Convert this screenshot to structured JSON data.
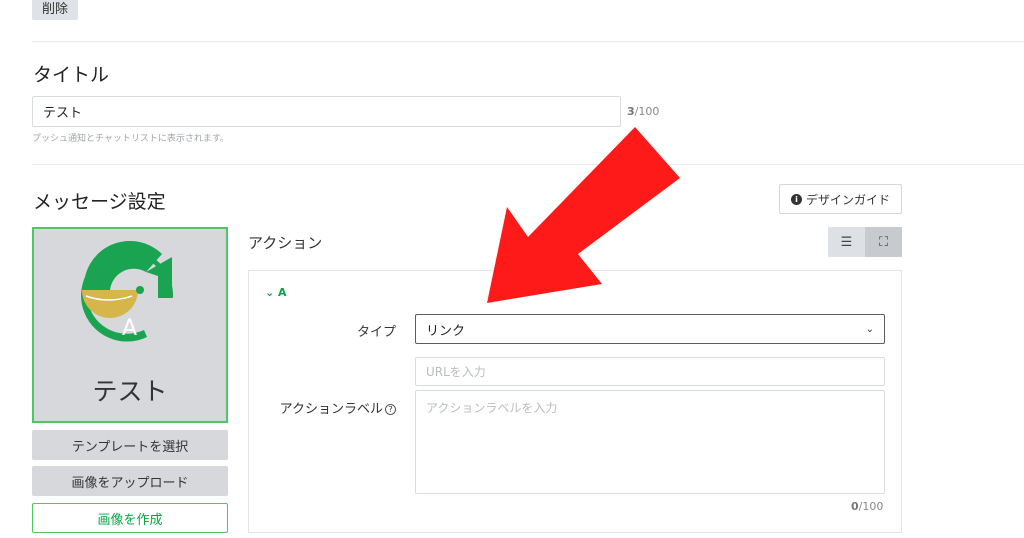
{
  "header": {
    "delete_label": "削除"
  },
  "title_section": {
    "heading": "タイトル",
    "input_value": "テスト",
    "counter_current": "3",
    "counter_max": "/100",
    "hint": "プッシュ通知とチャットリストに表示されます。"
  },
  "message_section": {
    "heading": "メッセージ設定",
    "design_guide_label": "デザインガイド"
  },
  "preview": {
    "area_label": "A",
    "text": "テスト",
    "buttons": [
      "テンプレートを選択",
      "画像をアップロード",
      "画像を作成"
    ]
  },
  "action": {
    "heading": "アクション",
    "collapse_label": "A",
    "type_label": "タイプ",
    "type_value": "リンク",
    "url_placeholder": "URLを入力",
    "action_label_label": "アクションラベル",
    "action_label_placeholder": "アクションラベルを入力",
    "counter_current": "0",
    "counter_max": "/100"
  },
  "colors": {
    "accent_green": "#06a644",
    "border_green": "#4cc764",
    "arrow_red": "#ff1a1a"
  },
  "icons": [
    "info-icon",
    "list-view-icon",
    "fullscreen-icon",
    "chevron-down-icon",
    "help-icon",
    "logo-image",
    "red-arrow-annotation"
  ]
}
